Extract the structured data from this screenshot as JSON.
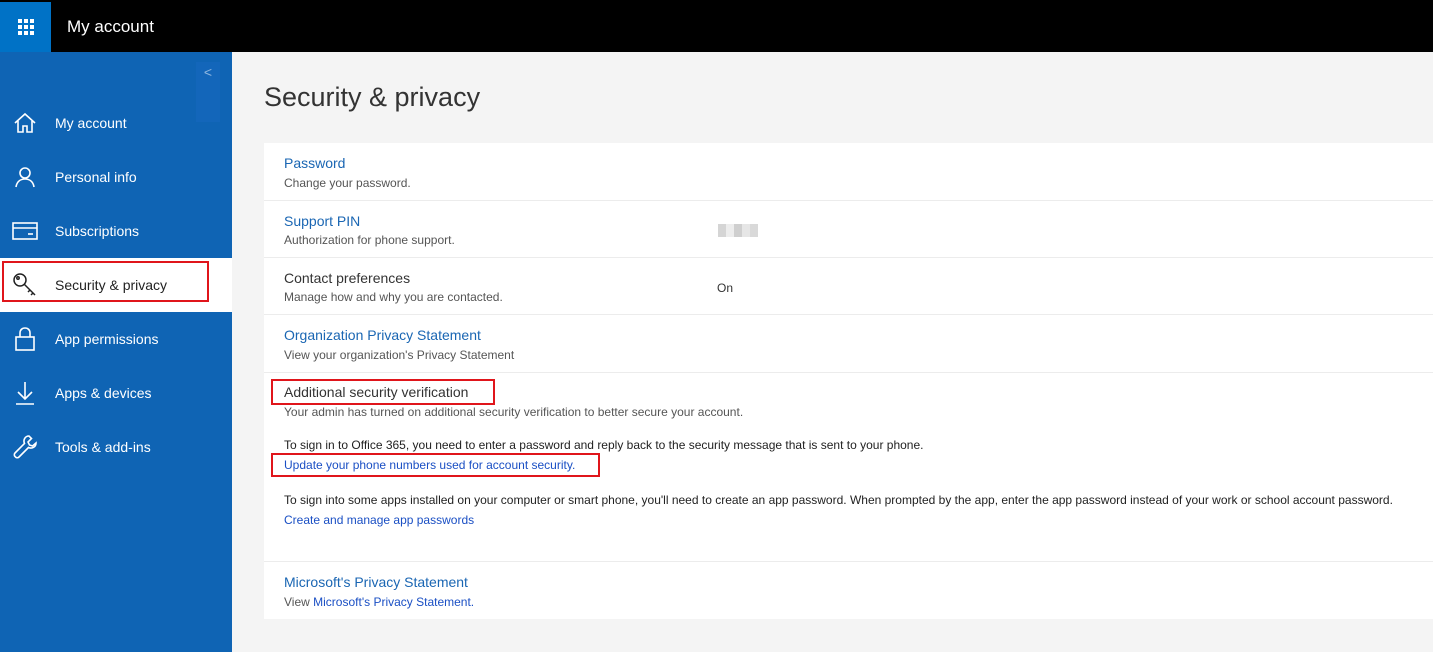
{
  "header": {
    "app_launcher_icon": "waffle-icon",
    "title": "My account"
  },
  "sidebar": {
    "collapse_icon": "chevron-left-icon",
    "collapse_glyph": "<",
    "items": [
      {
        "label": "My account",
        "icon": "home-icon"
      },
      {
        "label": "Personal info",
        "icon": "person-icon"
      },
      {
        "label": "Subscriptions",
        "icon": "card-icon"
      },
      {
        "label": "Security & privacy",
        "icon": "key-icon",
        "active": true
      },
      {
        "label": "App permissions",
        "icon": "lock-icon"
      },
      {
        "label": "Apps & devices",
        "icon": "download-icon"
      },
      {
        "label": "Tools & add-ins",
        "icon": "wrench-icon"
      }
    ]
  },
  "main": {
    "title": "Security & privacy",
    "rows": [
      {
        "title": "Password",
        "desc": "Change your password."
      },
      {
        "title": "Support PIN",
        "desc": "Authorization for phone support."
      },
      {
        "title": "Contact preferences",
        "desc": "Manage how and why you are contacted.",
        "value": "On"
      },
      {
        "title": "Organization Privacy Statement",
        "desc": "View your organization's Privacy Statement"
      },
      {
        "title": "Additional security verification",
        "desc": "Your admin has turned on additional security verification to better secure your account.",
        "para1": "To sign in to Office 365, you need to enter a password and reply back to the security message that is sent to your phone.",
        "link1": "Update your phone numbers used for account security.",
        "para2": "To sign into some apps installed on your computer or smart phone, you'll need to create an app password. When prompted by the app, enter the app password instead of your work or school account password.",
        "link2": "Create and manage app passwords"
      },
      {
        "title": "Microsoft's Privacy Statement",
        "desc_prefix": "View ",
        "desc_link": "Microsoft's Privacy Statement."
      }
    ]
  },
  "colors": {
    "sidebar_bg": "#0f64b4",
    "topbar_bg": "#000000",
    "accent": "#0072c6",
    "highlight": "#e0151b",
    "link": "#1a66b3"
  }
}
